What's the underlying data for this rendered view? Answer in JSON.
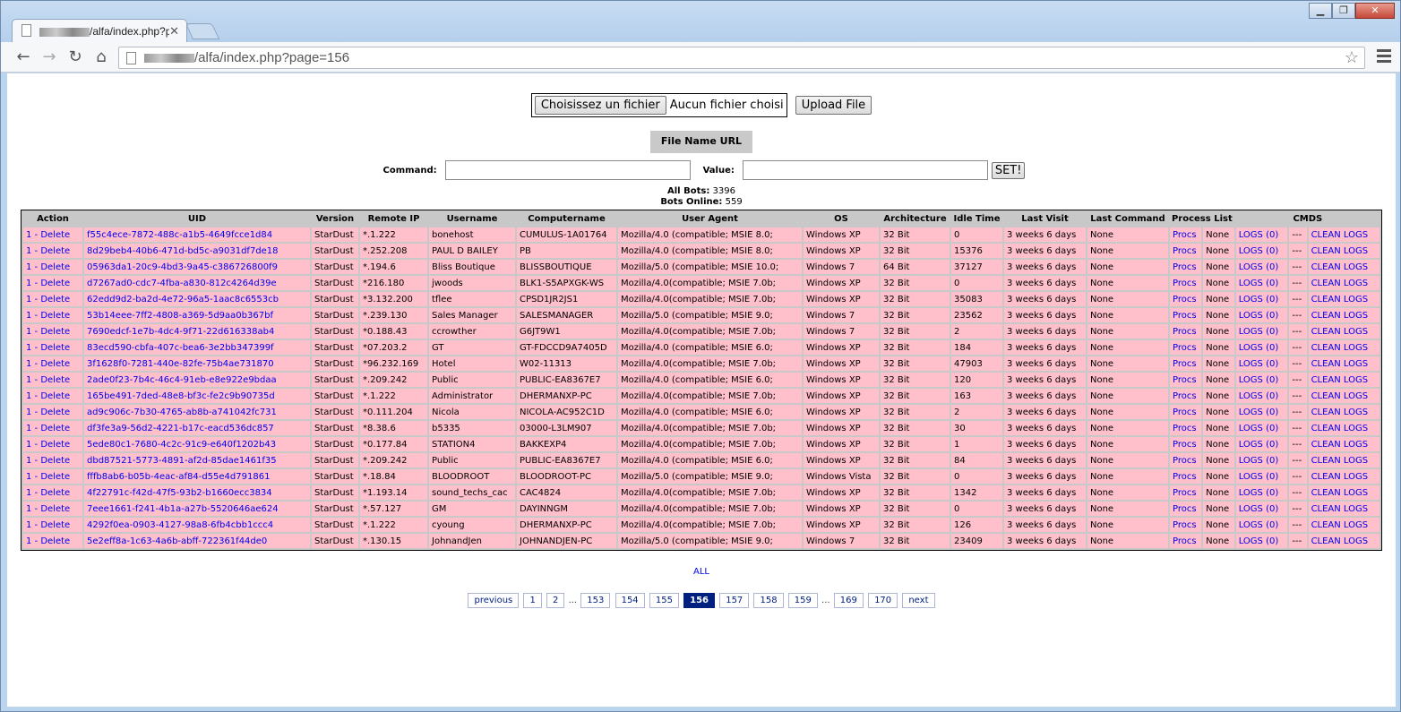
{
  "browser": {
    "tab_title": "/alfa/index.php?p",
    "url": "/alfa/index.php?page=156"
  },
  "upload": {
    "choose_label": "Choisissez un fichier",
    "no_file_label": "Aucun fichier choisi",
    "upload_label": "Upload File"
  },
  "url_box": {
    "label": "File Name  URL"
  },
  "command": {
    "command_label": "Command:",
    "value_label": "Value:",
    "set_label": "SET!",
    "command_value": "",
    "value_value": ""
  },
  "stats": {
    "all_bots_label": "All Bots:",
    "all_bots_value": "3396",
    "online_label": "Bots Online:",
    "online_value": "559"
  },
  "table": {
    "headers": [
      "Action",
      "UID",
      "Version",
      "Remote IP",
      "Username",
      "Computername",
      "User Agent",
      "OS",
      "Architecture",
      "Idle Time",
      "Last Visit",
      "Last Command",
      "Process List",
      "CMDS"
    ],
    "rows": [
      [
        "1 - Delete",
        "f55c4ece-7872-488c-a1b5-4649fcce1d84",
        "StarDust",
        "*.1.222",
        "bonehost",
        "CUMULUS-1A01764",
        "Mozilla/4.0 (compatible; MSIE 8.0;",
        "Windows XP",
        "32 Bit",
        "0",
        "3 weeks 6 days",
        "None",
        "Procs",
        "None",
        "LOGS (0)",
        "---",
        "CLEAN LOGS"
      ],
      [
        "1 - Delete",
        "8d29beb4-40b6-471d-bd5c-a9031df7de18",
        "StarDust",
        "*.252.208",
        "PAUL D BAILEY",
        "PB",
        "Mozilla/4.0 (compatible; MSIE 8.0;",
        "Windows XP",
        "32 Bit",
        "15376",
        "3 weeks 6 days",
        "None",
        "Procs",
        "None",
        "LOGS (0)",
        "---",
        "CLEAN LOGS"
      ],
      [
        "1 - Delete",
        "05963da1-20c9-4bd3-9a45-c386726800f9",
        "StarDust",
        "*.194.6",
        "Bliss Boutique",
        "BLISSBOUTIQUE",
        "Mozilla/5.0 (compatible; MSIE 10.0;",
        "Windows 7",
        "64 Bit",
        "37127",
        "3 weeks 6 days",
        "None",
        "Procs",
        "None",
        "LOGS (0)",
        "---",
        "CLEAN LOGS"
      ],
      [
        "1 - Delete",
        "d7267ad0-cdc7-4fba-a830-812c4264d39e",
        "StarDust",
        "*216.180",
        "jwoods",
        "BLK1-S5APXGK-WS",
        "Mozilla/4.0(compatible; MSIE 7.0b;",
        "Windows XP",
        "32 Bit",
        "0",
        "3 weeks 6 days",
        "None",
        "Procs",
        "None",
        "LOGS (0)",
        "---",
        "CLEAN LOGS"
      ],
      [
        "1 - Delete",
        "62edd9d2-ba2d-4e72-96a5-1aac8c6553cb",
        "StarDust",
        "*3.132.200",
        "tflee",
        "CPSD1JR2JS1",
        "Mozilla/4.0(compatible; MSIE 7.0b;",
        "Windows XP",
        "32 Bit",
        "35083",
        "3 weeks 6 days",
        "None",
        "Procs",
        "None",
        "LOGS (0)",
        "---",
        "CLEAN LOGS"
      ],
      [
        "1 - Delete",
        "53b14eee-7ff2-4808-a369-5d9aa0b367bf",
        "StarDust",
        "*.239.130",
        "Sales Manager",
        "SALESMANAGER",
        "Mozilla/5.0 (compatible; MSIE 9.0;",
        "Windows 7",
        "32 Bit",
        "23562",
        "3 weeks 6 days",
        "None",
        "Procs",
        "None",
        "LOGS (0)",
        "---",
        "CLEAN LOGS"
      ],
      [
        "1 - Delete",
        "7690edcf-1e7b-4dc4-9f71-22d616338ab4",
        "StarDust",
        "*0.188.43",
        "ccrowther",
        "G6JT9W1",
        "Mozilla/4.0(compatible; MSIE 7.0b;",
        "Windows 7",
        "32 Bit",
        "2",
        "3 weeks 6 days",
        "None",
        "Procs",
        "None",
        "LOGS (0)",
        "---",
        "CLEAN LOGS"
      ],
      [
        "1 - Delete",
        "83ecd590-cbfa-407c-bea6-3e2bb347399f",
        "StarDust",
        "*07.203.2",
        "GT",
        "GT-FDCCD9A7405D",
        "Mozilla/4.0 (compatible; MSIE 6.0;",
        "Windows XP",
        "32 Bit",
        "184",
        "3 weeks 6 days",
        "None",
        "Procs",
        "None",
        "LOGS (0)",
        "---",
        "CLEAN LOGS"
      ],
      [
        "1 - Delete",
        "3f1628f0-7281-440e-82fe-75b4ae731870",
        "StarDust",
        "*96.232.169",
        "Hotel",
        "W02-11313",
        "Mozilla/4.0(compatible; MSIE 7.0b;",
        "Windows XP",
        "32 Bit",
        "47903",
        "3 weeks 6 days",
        "None",
        "Procs",
        "None",
        "LOGS (0)",
        "---",
        "CLEAN LOGS"
      ],
      [
        "1 - Delete",
        "2ade0f23-7b4c-46c4-91eb-e8e922e9bdaa",
        "StarDust",
        "*.209.242",
        "Public",
        "PUBLIC-EA8367E7",
        "Mozilla/4.0 (compatible; MSIE 6.0;",
        "Windows XP",
        "32 Bit",
        "120",
        "3 weeks 6 days",
        "None",
        "Procs",
        "None",
        "LOGS (0)",
        "---",
        "CLEAN LOGS"
      ],
      [
        "1 - Delete",
        "165be491-7ded-48e8-bf3c-fe2c9b90735d",
        "StarDust",
        "*.1.222",
        "Administrator",
        "DHERMANXP-PC",
        "Mozilla/4.0(compatible; MSIE 7.0b;",
        "Windows XP",
        "32 Bit",
        "163",
        "3 weeks 6 days",
        "None",
        "Procs",
        "None",
        "LOGS (0)",
        "---",
        "CLEAN LOGS"
      ],
      [
        "1 - Delete",
        "ad9c906c-7b30-4765-ab8b-a741042fc731",
        "StarDust",
        "*0.111.204",
        "Nicola",
        "NICOLA-AC952C1D",
        "Mozilla/4.0 (compatible; MSIE 6.0;",
        "Windows XP",
        "32 Bit",
        "2",
        "3 weeks 6 days",
        "None",
        "Procs",
        "None",
        "LOGS (0)",
        "---",
        "CLEAN LOGS"
      ],
      [
        "1 - Delete",
        "df3fe3a9-56d2-4221-b17c-eacd536dc857",
        "StarDust",
        "*8.38.6",
        "b5335",
        "03000-L3LM907",
        "Mozilla/4.0(compatible; MSIE 7.0b;",
        "Windows XP",
        "32 Bit",
        "30",
        "3 weeks 6 days",
        "None",
        "Procs",
        "None",
        "LOGS (0)",
        "---",
        "CLEAN LOGS"
      ],
      [
        "1 - Delete",
        "5ede80c1-7680-4c2c-91c9-e640f1202b43",
        "StarDust",
        "*0.177.84",
        "STATION4",
        "BAKKEXP4",
        "Mozilla/4.0(compatible; MSIE 7.0b;",
        "Windows XP",
        "32 Bit",
        "1",
        "3 weeks 6 days",
        "None",
        "Procs",
        "None",
        "LOGS (0)",
        "---",
        "CLEAN LOGS"
      ],
      [
        "1 - Delete",
        "dbd87521-5773-4891-af2d-85dae1461f35",
        "StarDust",
        "*.209.242",
        "Public",
        "PUBLIC-EA8367E7",
        "Mozilla/4.0 (compatible; MSIE 6.0;",
        "Windows XP",
        "32 Bit",
        "84",
        "3 weeks 6 days",
        "None",
        "Procs",
        "None",
        "LOGS (0)",
        "---",
        "CLEAN LOGS"
      ],
      [
        "1 - Delete",
        "fffb8ab6-b05b-4eac-af84-d55e4d791861",
        "StarDust",
        "*.18.84",
        "BLOODROOT",
        "BLOODROOT-PC",
        "Mozilla/5.0 (compatible; MSIE 9.0;",
        "Windows Vista",
        "32 Bit",
        "0",
        "3 weeks 6 days",
        "None",
        "Procs",
        "None",
        "LOGS (0)",
        "---",
        "CLEAN LOGS"
      ],
      [
        "1 - Delete",
        "4f22791c-f42d-47f5-93b2-b1660ecc3834",
        "StarDust",
        "*1.193.14",
        "sound_techs_cac",
        "CAC4824",
        "Mozilla/4.0(compatible; MSIE 7.0b;",
        "Windows XP",
        "32 Bit",
        "1342",
        "3 weeks 6 days",
        "None",
        "Procs",
        "None",
        "LOGS (0)",
        "---",
        "CLEAN LOGS"
      ],
      [
        "1 - Delete",
        "7eee1661-f241-4b1a-a27b-5520646ae624",
        "StarDust",
        "*.57.127",
        "GM",
        "DAYINNGM",
        "Mozilla/4.0(compatible; MSIE 7.0b;",
        "Windows XP",
        "32 Bit",
        "0",
        "3 weeks 6 days",
        "None",
        "Procs",
        "None",
        "LOGS (0)",
        "---",
        "CLEAN LOGS"
      ],
      [
        "1 - Delete",
        "4292f0ea-0903-4127-98a8-6fb4cbb1ccc4",
        "StarDust",
        "*.1.222",
        "cyoung",
        "DHERMANXP-PC",
        "Mozilla/4.0(compatible; MSIE 7.0b;",
        "Windows XP",
        "32 Bit",
        "126",
        "3 weeks 6 days",
        "None",
        "Procs",
        "None",
        "LOGS (0)",
        "---",
        "CLEAN LOGS"
      ],
      [
        "1 - Delete",
        "5e2eff8a-1c63-4a6b-abff-722361f44de0",
        "StarDust",
        "*.130.15",
        "JohnandJen",
        "JOHNANDJEN-PC",
        "Mozilla/5.0 (compatible; MSIE 9.0;",
        "Windows 7",
        "32 Bit",
        "23409",
        "3 weeks 6 days",
        "None",
        "Procs",
        "None",
        "LOGS (0)",
        "---",
        "CLEAN LOGS"
      ]
    ]
  },
  "pagination": {
    "all_label": "ALL",
    "previous_label": "previous",
    "next_label": "next",
    "dots": "...",
    "pages_before": [
      "1",
      "2"
    ],
    "pages_middle": [
      "153",
      "154",
      "155"
    ],
    "current": "156",
    "pages_after": [
      "157",
      "158",
      "159"
    ],
    "pages_end": [
      "169",
      "170"
    ]
  },
  "colors": {
    "row_bg": "#ffc0cb",
    "table_bg": "#c8c8c8",
    "link": "#0000ee",
    "pager_current": "#00207f"
  }
}
